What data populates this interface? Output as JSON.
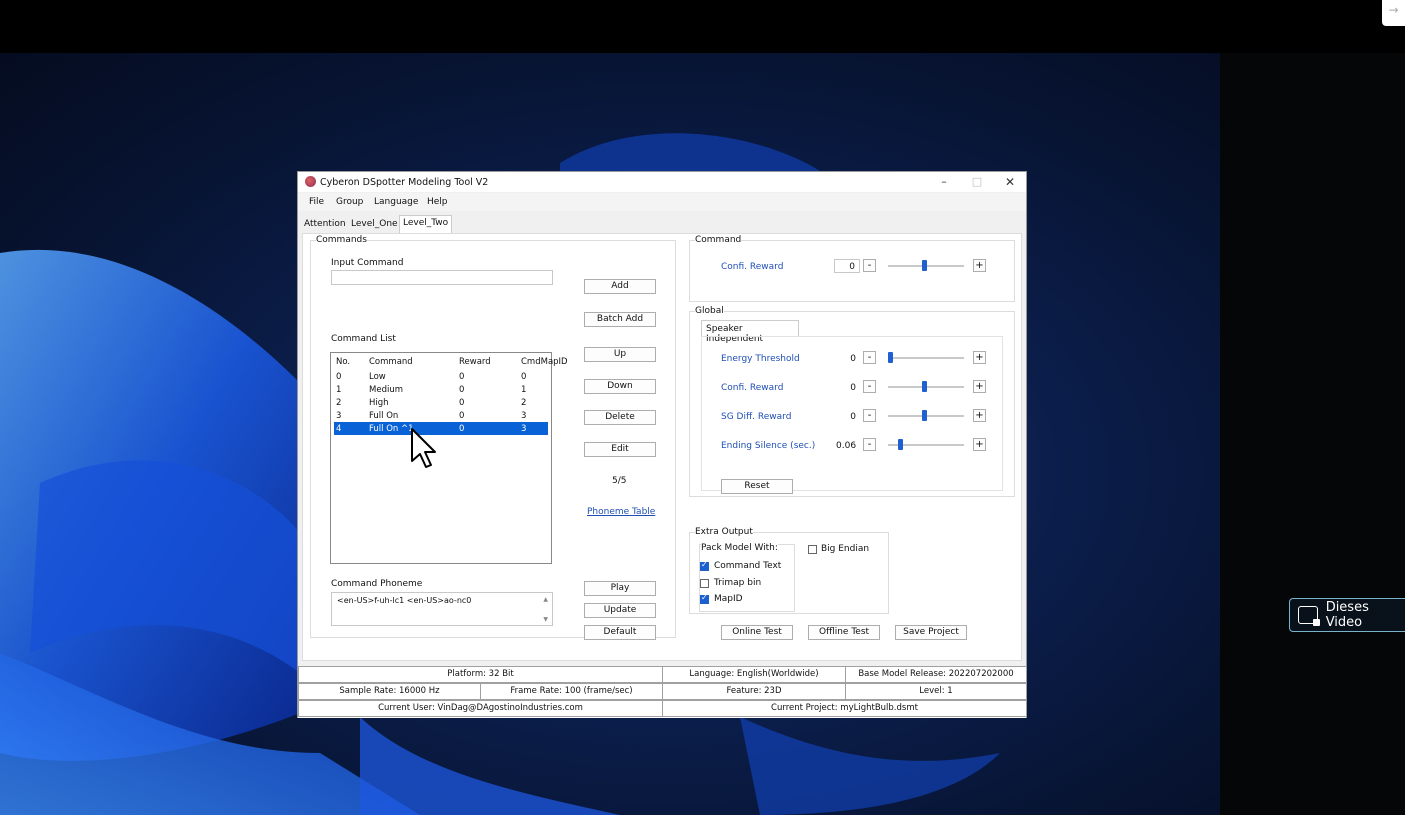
{
  "colors": {
    "accent": "#0a63d6",
    "link": "#1f4fb5",
    "checkbox_checked": "#1c5fcf"
  },
  "window": {
    "title": "Cyberon DSpotter Modeling Tool V2",
    "controls": {
      "minimize": "–",
      "maximize": "□",
      "close": "✕"
    }
  },
  "menu": {
    "file": "File",
    "group": "Group",
    "language": "Language",
    "help": "Help"
  },
  "tabs": [
    "Attention",
    "Level_One",
    "Level_Two"
  ],
  "active_tab": "Level_Two",
  "commands": {
    "group_label": "Commands",
    "input_label": "Input Command",
    "input_value": "",
    "list_label": "Command List",
    "columns": {
      "no": "No.",
      "command": "Command",
      "reward": "Reward",
      "mapid": "CmdMapID"
    },
    "rows": [
      {
        "no": "0",
        "command": "Low",
        "reward": "0",
        "mapid": "0"
      },
      {
        "no": "1",
        "command": "Medium",
        "reward": "0",
        "mapid": "1"
      },
      {
        "no": "2",
        "command": "High",
        "reward": "0",
        "mapid": "2"
      },
      {
        "no": "3",
        "command": "Full On",
        "reward": "0",
        "mapid": "3"
      },
      {
        "no": "4",
        "command": "Full On ^1",
        "reward": "0",
        "mapid": "3"
      }
    ],
    "phoneme_label": "Command Phoneme",
    "phoneme_value": "<en-US>f-uh-lc1 <en-US>ao-nc0",
    "count": "5/5",
    "phoneme_table_link": "Phoneme Table"
  },
  "buttons": {
    "add": "Add",
    "batch_add": "Batch Add",
    "up": "Up",
    "down": "Down",
    "delete": "Delete",
    "edit": "Edit",
    "play": "Play",
    "update": "Update",
    "default": "Default",
    "reset": "Reset",
    "online_test": "Online Test",
    "offline_test": "Offline Test",
    "save_project": "Save Project",
    "minus": "-",
    "plus": "+"
  },
  "command_panel": {
    "label": "Command",
    "confi_reward_label": "Confi. Reward",
    "confi_reward_value": "0"
  },
  "global": {
    "label": "Global",
    "tab": "Speaker Independent",
    "energy_threshold": {
      "label": "Energy Threshold",
      "value": "0"
    },
    "confi_reward": {
      "label": "Confi. Reward",
      "value": "0"
    },
    "sg_diff_reward": {
      "label": "SG Diff. Reward",
      "value": "0"
    },
    "ending_silence": {
      "label": "Ending Silence (sec.)",
      "value": "0.06"
    }
  },
  "extra_output": {
    "label": "Extra Output",
    "pack_label": "Pack Model With:",
    "command_text": "Command Text",
    "trimap_bin": "Trimap bin",
    "mapid": "MapID",
    "big_endian": "Big Endian"
  },
  "status": {
    "platform": "Platform: 32 Bit",
    "language": "Language: English(Worldwide)",
    "base_model": "Base Model Release: 202207202000",
    "sample_rate": "Sample Rate: 16000 Hz",
    "frame_rate": "Frame Rate: 100 (frame/sec)",
    "feature": "Feature: 23D",
    "level": "Level: 1",
    "current_user": "Current User: VinDag@DAgostinoIndustries.com",
    "current_project": "Current Project: myLightBulb.dsmt"
  },
  "overlay": {
    "label": "Dieses Video"
  },
  "corner": {
    "arrow": "→"
  }
}
